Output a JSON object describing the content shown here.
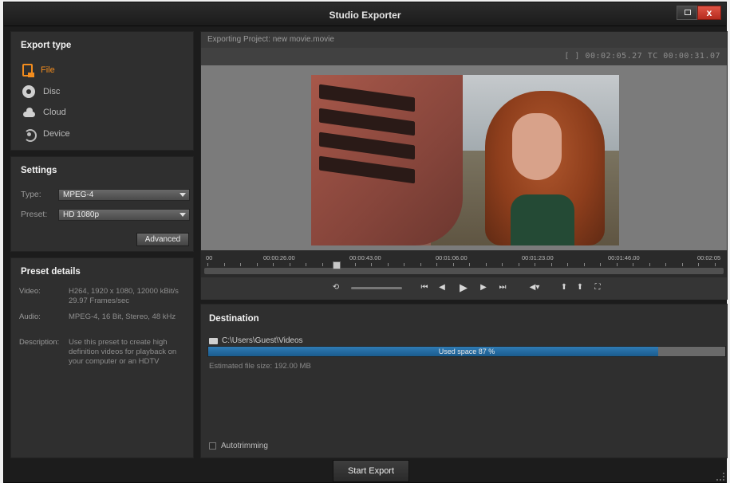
{
  "window": {
    "title": "Studio Exporter",
    "close_label": "x"
  },
  "export_type": {
    "heading": "Export type",
    "items": [
      {
        "label": "File",
        "icon": "file-icon",
        "active": true
      },
      {
        "label": "Disc",
        "icon": "disc-icon",
        "active": false
      },
      {
        "label": "Cloud",
        "icon": "cloud-icon",
        "active": false
      },
      {
        "label": "Device",
        "icon": "device-icon",
        "active": false
      }
    ]
  },
  "settings": {
    "heading": "Settings",
    "type_label": "Type:",
    "type_value": "MPEG-4",
    "preset_label": "Preset:",
    "preset_value": "HD 1080p",
    "advanced_label": "Advanced"
  },
  "preset_details": {
    "heading": "Preset details",
    "video_label": "Video:",
    "video_value": "H264, 1920 x 1080, 12000 kBit/s 29.97 Frames/sec",
    "audio_label": "Audio:",
    "audio_value": "MPEG-4, 16 Bit, Stereo, 48 kHz",
    "description_label": "Description:",
    "description_value": "Use this preset to create high definition videos for playback on your computer or an HDTV"
  },
  "preview": {
    "project_label": "Exporting Project: new movie.movie",
    "timecode": "[ ] 00:02:05.27   TC 00:00:31.07",
    "ruler": [
      "00",
      "00:00:26.00",
      "00:00:43.00",
      "00:01:06.00",
      "00:01:23.00",
      "00:01:46.00",
      "00:02:05"
    ],
    "playhead_fraction": 0.25
  },
  "destination": {
    "heading": "Destination",
    "path": "C:\\Users\\Guest\\Videos",
    "used_space_label": "Used space 87 %",
    "used_fraction": 0.87,
    "estimated_size": "Estimated file size: 192.00 MB",
    "autotrim_label": "Autotrimming"
  },
  "start_export_label": "Start Export",
  "colors": {
    "accent": "#f28c1e",
    "progress": "#2f7bb5"
  }
}
